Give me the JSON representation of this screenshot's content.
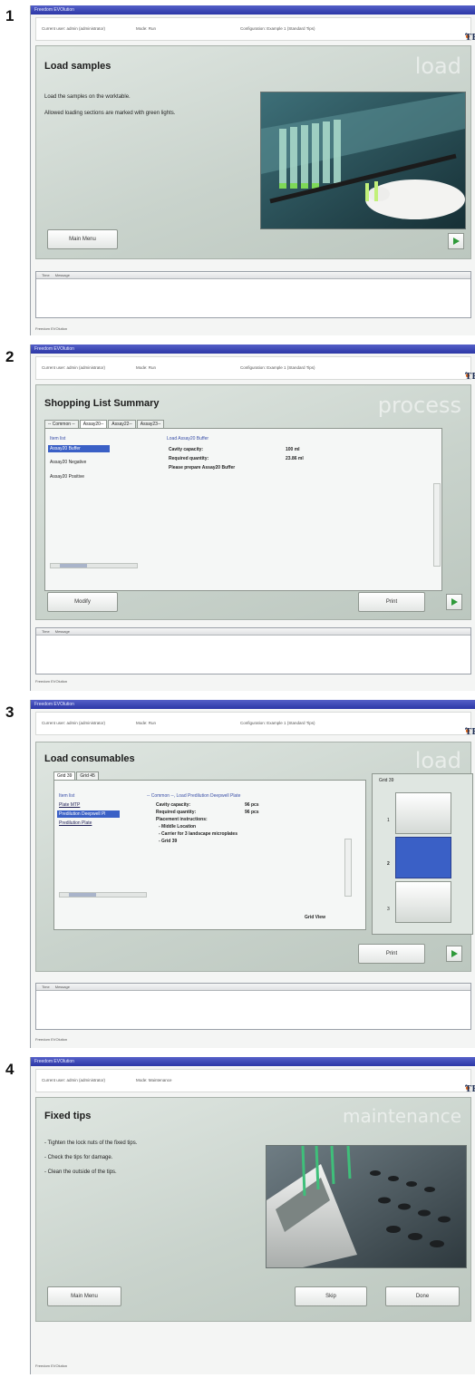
{
  "steps": [
    {
      "number": "1",
      "window_title": "Freedom EVOlution",
      "info": {
        "user": "Current user: admin (administrator)",
        "mode": "Mode: Run",
        "config": "Configuration: Example 1 (Standard Tips)"
      },
      "logo": "TECAN",
      "heading": "Load samples",
      "watermark": "load",
      "text1": "Load the samples on the worktable.",
      "text2": "Allowed loading sections are marked with green lights.",
      "main_menu_label": "Main Menu",
      "msg_time": "Time",
      "msg_message": "Message",
      "status": "Freedom EVOlution"
    },
    {
      "number": "2",
      "window_title": "Freedom EVOlution",
      "info": {
        "user": "Current user: admin (administrator)",
        "mode": "Mode: Run",
        "config": "Configuration: Example 1 (Standard Tips)"
      },
      "logo": "TECAN",
      "heading": "Shopping List Summary",
      "watermark": "process",
      "tabs": [
        "-- Common --",
        "Assay20--",
        "Assay22--",
        "Assay23--"
      ],
      "list_header": "Item list",
      "items": [
        "Assay20 Buffer",
        "Assay20 Negative",
        "Assay20 Positive"
      ],
      "detail_title": "Load Assay20 Buffer",
      "cavity_label": "Cavity capacity:",
      "cavity_value": "100 ml",
      "required_label": "Required quantity:",
      "required_value": "23.86 ml",
      "prepare_text": "Please prepare Assay20 Buffer",
      "modify_label": "Modify",
      "print_label": "Print",
      "msg_time": "Time",
      "msg_message": "Message",
      "status": "Freedom EVOlution"
    },
    {
      "number": "3",
      "window_title": "Freedom EVOlution",
      "info": {
        "user": "Current user: admin (administrator)",
        "mode": "Mode: Run",
        "config": "Configuration: Example 1 (Standard Tips)"
      },
      "logo": "TECAN",
      "heading": "Load consumables",
      "watermark": "load",
      "tabs": [
        "Grid 39",
        "Grid 45"
      ],
      "list_header": "Item list",
      "items": [
        "Plate MTP",
        "Predilution Deepwell Pl",
        "Predilution Plate"
      ],
      "detail_title": "-- Common --, Load Predilution Deepwell Plate",
      "cavity_label": "Cavity capacity:",
      "cavity_value": "96 pcs",
      "required_label": "Required quantity:",
      "required_value": "96 pcs",
      "placement_label": "Placement instructions:",
      "placement_items": [
        "- Middle Location",
        "- Carrier for 3 landscape microplates",
        "- Grid 39"
      ],
      "grid_view": "Grid View",
      "grid_label": "Grid 39",
      "grid_positions": [
        "1",
        "2",
        "3"
      ],
      "print_label": "Print",
      "msg_time": "Time",
      "msg_message": "Message",
      "status": "Freedom EVOlution"
    },
    {
      "number": "4",
      "window_title": "Freedom EVOlution",
      "info": {
        "user": "Current user: admin (administrator)",
        "mode": "Mode: Maintenance"
      },
      "logo": "TECAN",
      "heading": "Fixed tips",
      "watermark": "maintenance",
      "bullets": [
        "- Tighten the lock nuts of the fixed tips.",
        "- Check the tips for damage.",
        "- Clean the outside of the tips."
      ],
      "main_menu_label": "Main Menu",
      "skip_label": "Skip",
      "done_label": "Done",
      "status": "Freedom EVOlution"
    }
  ],
  "colors": {
    "titlebar": "#2c37a6",
    "selection": "#3a60c6",
    "go_arrow": "#2f9a3a",
    "logo_dot": "#e26a1b"
  },
  "icons": {
    "go": "play-arrow-icon",
    "logo": "tecan-logo"
  }
}
